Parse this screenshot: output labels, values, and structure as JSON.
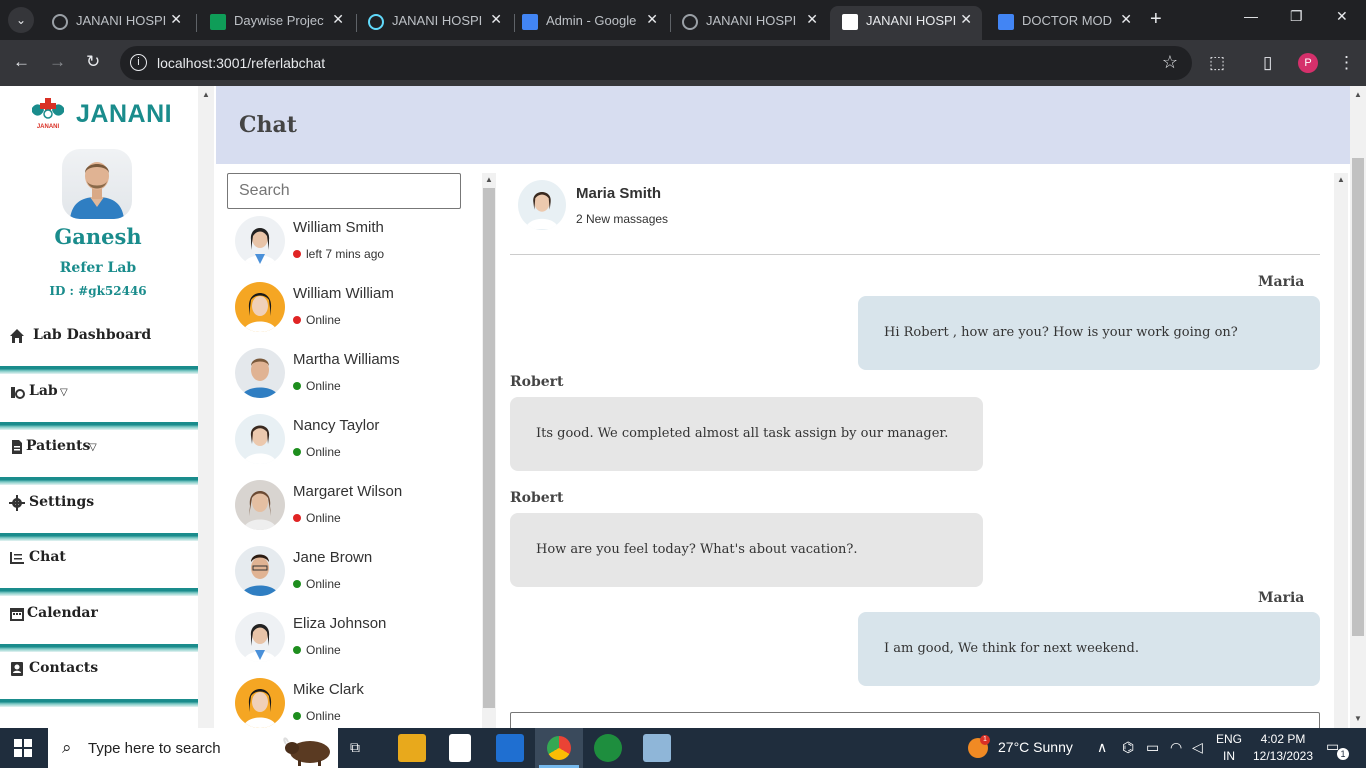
{
  "browser": {
    "tabs": [
      {
        "title": "JANANI HOSPITAL",
        "favicon": "globe-icon",
        "active": false
      },
      {
        "title": "Daywise Project",
        "favicon": "sheets-icon",
        "active": false
      },
      {
        "title": "JANANI HOSPITAL",
        "favicon": "react-icon",
        "active": false
      },
      {
        "title": "Admin - Google",
        "favicon": "docs-icon",
        "active": false
      },
      {
        "title": "JANANI HOSPITAL",
        "favicon": "globe-icon",
        "active": false
      },
      {
        "title": "JANANI HOSPITAL",
        "favicon": "janani-icon",
        "active": true
      },
      {
        "title": "DOCTOR MODULE",
        "favicon": "docs-icon",
        "active": false
      }
    ],
    "url": "localhost:3001/referlabchat",
    "profile_initial": "P"
  },
  "sidebar": {
    "logo_text": "JANANI",
    "logo_small": "JANANI",
    "user_name": "Ganesh",
    "user_role": "Refer Lab",
    "user_id": "ID : #gk52446",
    "menu": [
      {
        "label": "Lab Dashboard",
        "icon": "home-icon",
        "has_dropdown": false
      },
      {
        "label": "Lab",
        "icon": "lab-icon",
        "has_dropdown": true
      },
      {
        "label": "Patients",
        "icon": "file-icon",
        "has_dropdown": true
      },
      {
        "label": "Settings",
        "icon": "gear-icon",
        "has_dropdown": false
      },
      {
        "label": "Chat",
        "icon": "list-icon",
        "has_dropdown": false
      },
      {
        "label": "Calendar",
        "icon": "calendar-icon",
        "has_dropdown": false
      },
      {
        "label": "Contacts",
        "icon": "contact-card-icon",
        "has_dropdown": false
      }
    ]
  },
  "header": {
    "title": "Chat"
  },
  "contacts": {
    "search_placeholder": "Search",
    "items": [
      {
        "name": "William Smith",
        "status": "left 7 mins ago",
        "status_color": "#e02424"
      },
      {
        "name": "William William",
        "status": "Online",
        "status_color": "#e02424"
      },
      {
        "name": "Martha Williams",
        "status": "Online",
        "status_color": "#1e8e1e"
      },
      {
        "name": "Nancy Taylor",
        "status": "Online",
        "status_color": "#1e8e1e"
      },
      {
        "name": "Margaret Wilson",
        "status": "Online",
        "status_color": "#e02424"
      },
      {
        "name": "Jane Brown",
        "status": "Online",
        "status_color": "#1e8e1e"
      },
      {
        "name": "Eliza Johnson",
        "status": "Online",
        "status_color": "#1e8e1e"
      },
      {
        "name": "Mike Clark",
        "status": "Online",
        "status_color": "#1e8e1e"
      }
    ]
  },
  "chat": {
    "contact_name": "Maria Smith",
    "subtitle": "2 New massages",
    "messages": [
      {
        "sender": "Maria",
        "text": "Hi Robert , how are you? How is your work going on?",
        "direction": "out"
      },
      {
        "sender": "Robert",
        "text": "Its good. We completed almost all task assign by our manager.",
        "direction": "in"
      },
      {
        "sender": "Robert",
        "text": "How are you feel today? What's about vacation?.",
        "direction": "in"
      },
      {
        "sender": "Maria",
        "text": "I am good, We think for next weekend.",
        "direction": "out"
      }
    ]
  },
  "taskbar": {
    "search_text": "Type here to search",
    "weather_badge": "1",
    "weather": "27°C  Sunny",
    "lang": "ENG",
    "region": "IN",
    "time": "4:02 PM",
    "date": "12/13/2023",
    "notifications": "1"
  },
  "colors": {
    "brand": "#1a8c8c",
    "header_bg": "#d7ddf0",
    "online": "#1e8e1e",
    "offline": "#e02424"
  }
}
